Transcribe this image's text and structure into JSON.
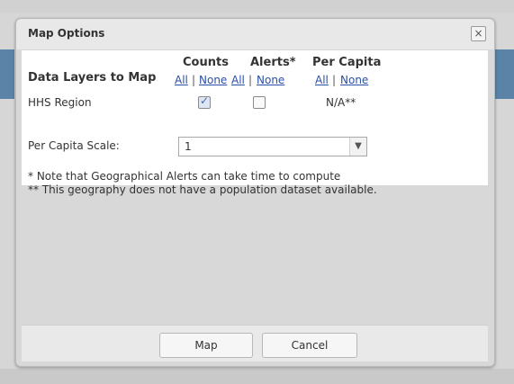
{
  "dialog": {
    "title": "Map Options",
    "close_symbol": "×"
  },
  "header": {
    "data_layers": "Data Layers to Map",
    "counts": "Counts",
    "alerts": "Alerts*",
    "per_capita": "Per Capita"
  },
  "links": {
    "all": "All",
    "none": "None",
    "sep": "|"
  },
  "row": {
    "label": "HHS Region",
    "counts_checked": true,
    "alerts_checked": false,
    "per_capita_value": "N/A**"
  },
  "scale": {
    "label": "Per Capita Scale:",
    "value": "1"
  },
  "notes": {
    "note1": "* Note that Geographical Alerts can take time to compute",
    "note2": "** This geography does not have a population dataset available."
  },
  "buttons": {
    "map": "Map",
    "cancel": "Cancel"
  },
  "icons": {
    "close": "close-icon",
    "check": "checkmark-icon",
    "dropdown": "chevron-down-icon"
  }
}
